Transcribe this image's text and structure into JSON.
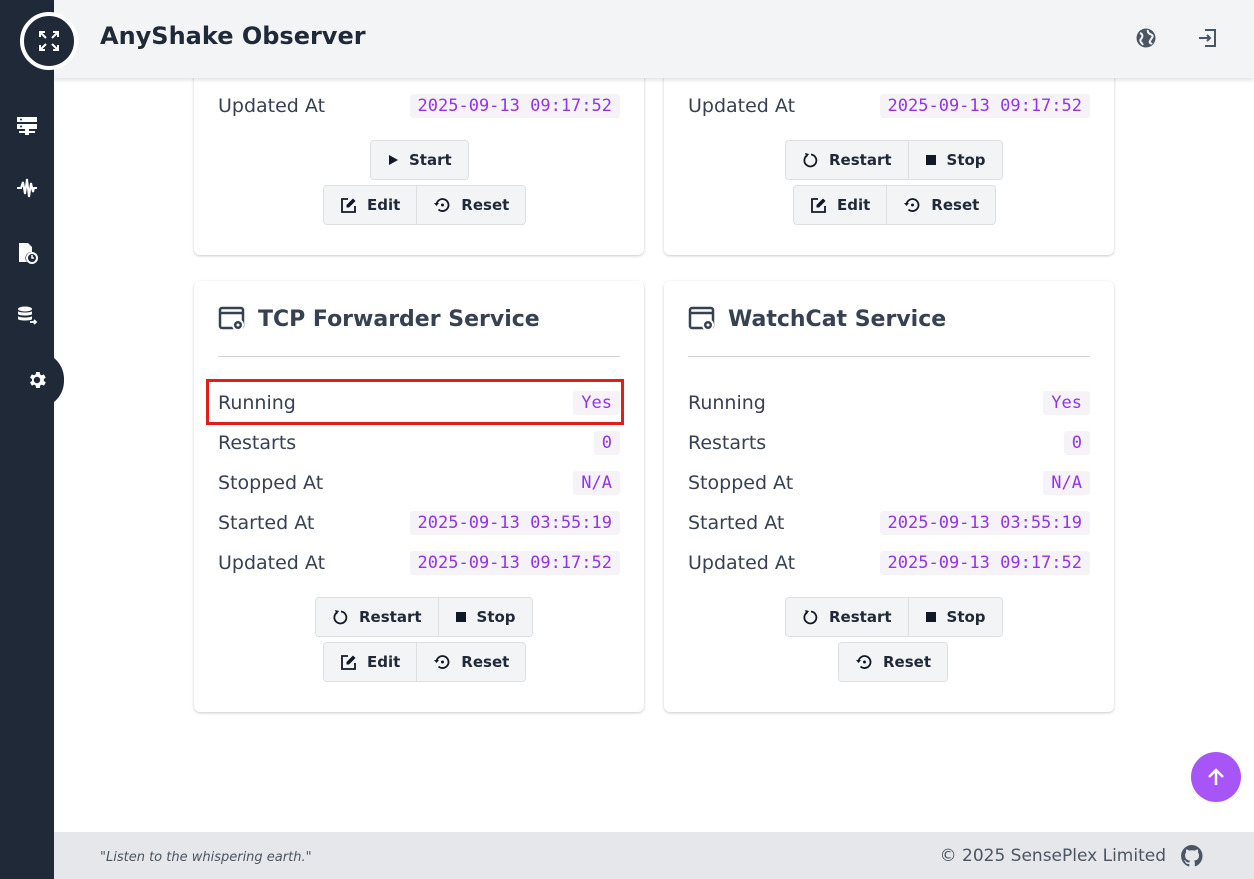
{
  "app": {
    "title": "AnyShake Observer"
  },
  "colors": {
    "sidebar": "#1f2937",
    "accent": "#a855f7",
    "value_text": "#9333ea",
    "highlight": "#e11d1d"
  },
  "sidebar": {
    "items": [
      {
        "icon": "server-icon"
      },
      {
        "icon": "waveform-icon"
      },
      {
        "icon": "file-history-icon"
      },
      {
        "icon": "database-export-icon"
      },
      {
        "icon": "gear-icon",
        "active": true
      }
    ]
  },
  "header": {
    "icons": [
      "globe-icon",
      "logout-icon"
    ]
  },
  "cards": {
    "top_left": {
      "rows": [
        {
          "label": "Updated At",
          "value": "2025-09-13 09:17:52"
        }
      ],
      "buttons": {
        "start": "Start",
        "edit": "Edit",
        "reset": "Reset"
      }
    },
    "top_right": {
      "rows": [
        {
          "label": "Updated At",
          "value": "2025-09-13 09:17:52"
        }
      ],
      "buttons": {
        "restart": "Restart",
        "stop": "Stop",
        "edit": "Edit",
        "reset": "Reset"
      }
    },
    "tcp": {
      "title": "TCP Forwarder Service",
      "rows": [
        {
          "label": "Running",
          "value": "Yes"
        },
        {
          "label": "Restarts",
          "value": "0"
        },
        {
          "label": "Stopped At",
          "value": "N/A"
        },
        {
          "label": "Started At",
          "value": "2025-09-13 03:55:19"
        },
        {
          "label": "Updated At",
          "value": "2025-09-13 09:17:52"
        }
      ],
      "buttons": {
        "restart": "Restart",
        "stop": "Stop",
        "edit": "Edit",
        "reset": "Reset"
      }
    },
    "watchcat": {
      "title": "WatchCat Service",
      "rows": [
        {
          "label": "Running",
          "value": "Yes"
        },
        {
          "label": "Restarts",
          "value": "0"
        },
        {
          "label": "Stopped At",
          "value": "N/A"
        },
        {
          "label": "Started At",
          "value": "2025-09-13 03:55:19"
        },
        {
          "label": "Updated At",
          "value": "2025-09-13 09:17:52"
        }
      ],
      "buttons": {
        "restart": "Restart",
        "stop": "Stop",
        "reset": "Reset"
      }
    }
  },
  "footer": {
    "motto": "\"Listen to the whispering earth.\"",
    "copyright": "© 2025 SensePlex Limited"
  }
}
